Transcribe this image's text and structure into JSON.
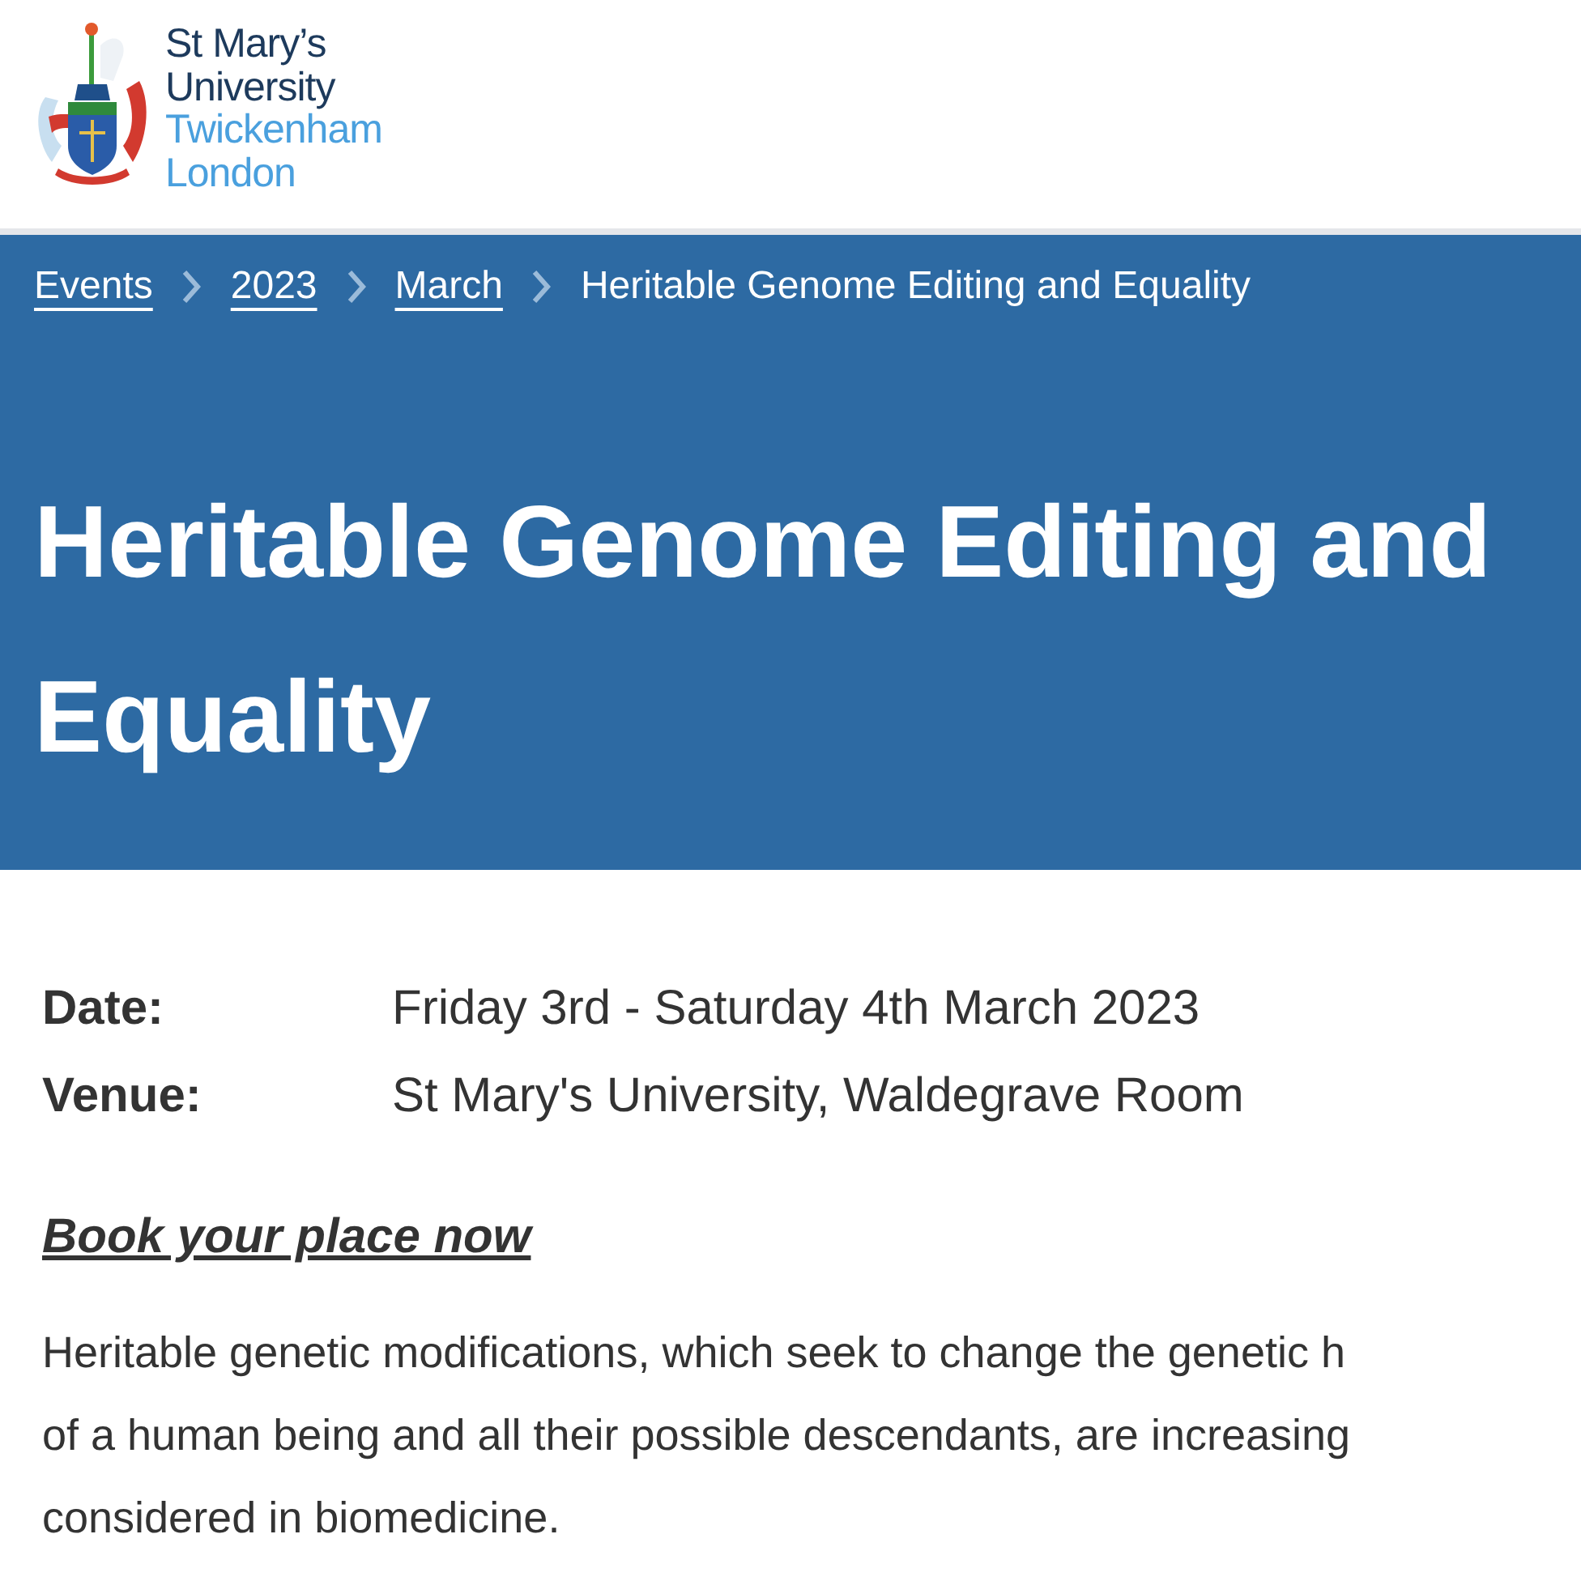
{
  "header": {
    "logo_lines": [
      {
        "text": "St Mary’s",
        "kind": "primary"
      },
      {
        "text": "University",
        "kind": "primary"
      },
      {
        "text": "Twickenham",
        "kind": "secondary"
      },
      {
        "text": "London",
        "kind": "secondary"
      }
    ]
  },
  "breadcrumb": [
    {
      "label": "Events",
      "kind": "link"
    },
    {
      "label": "2023",
      "kind": "link"
    },
    {
      "label": "March",
      "kind": "link"
    },
    {
      "label": "Heritable Genome Editing and Equality",
      "kind": "current"
    }
  ],
  "title": "Heritable Genome Editing and Equality",
  "details": [
    {
      "label": "Date:",
      "value": "Friday 3rd - Saturday 4th March 2023"
    },
    {
      "label": "Venue:",
      "value": "St Mary's University, Waldegrave Room"
    }
  ],
  "booking_link": "Book your place now",
  "paragraph_lines": [
    "Heritable genetic modifications, which seek to change the genetic h",
    "of a human being and all their possible descendants, are increasing",
    "considered in biomedicine."
  ]
}
